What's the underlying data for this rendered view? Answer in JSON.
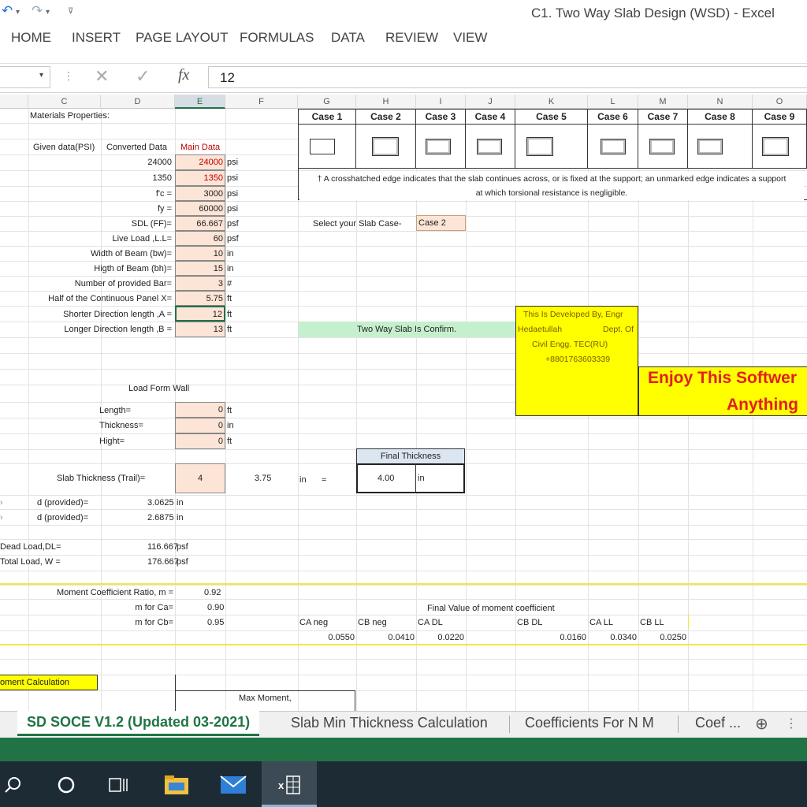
{
  "window": {
    "title": "C1. Two Way Slab Design (WSD) - Excel"
  },
  "ribbon": {
    "tabs": [
      "HOME",
      "INSERT",
      "PAGE LAYOUT",
      "FORMULAS",
      "DATA",
      "REVIEW",
      "VIEW"
    ]
  },
  "formula_bar": {
    "fx_label": "fx",
    "value": "12"
  },
  "columns": [
    "C",
    "D",
    "E",
    "F",
    "G",
    "H",
    "I",
    "J",
    "K",
    "L",
    "M",
    "N",
    "O"
  ],
  "materials": {
    "title": "Materials Properties:",
    "given_hdr": "Given data(PSI)",
    "converted_hdr": "Converted Data",
    "main_hdr": "Main Data",
    "rows": [
      {
        "given": "24000",
        "label": "",
        "main": "24000",
        "unit": "psi"
      },
      {
        "given": "1350",
        "label": "",
        "main": "1350",
        "unit": "psi"
      },
      {
        "given": "f'c =",
        "label": "",
        "main": "3000",
        "unit": "psi"
      },
      {
        "given": "fy =",
        "label": "",
        "main": "60000",
        "unit": "psi"
      },
      {
        "given": "",
        "label": "SDL (FF)=",
        "main": "66.667",
        "unit": "psf"
      },
      {
        "given": "",
        "label": "Live Load ,L.L=",
        "main": "60",
        "unit": "psf"
      },
      {
        "given": "",
        "label": "Width of Beam (bw)=",
        "main": "10",
        "unit": "in"
      },
      {
        "given": "",
        "label": "Higth of Beam (bh)=",
        "main": "15",
        "unit": "in"
      },
      {
        "given": "",
        "label": "Number of provided Bar=",
        "main": "3",
        "unit": "#"
      },
      {
        "given": "",
        "label": "Half of the Continuous Panel X=",
        "main": "5.75",
        "unit": "ft"
      },
      {
        "given": "",
        "label": "Shorter  Direction length ,A =",
        "main": "12",
        "unit": "ft"
      },
      {
        "given": "",
        "label": "Longer  Direction length ,B =",
        "main": "13",
        "unit": "ft"
      }
    ]
  },
  "cases": {
    "labels": [
      "Case 1",
      "Case 2",
      "Case 3",
      "Case 4",
      "Case 5",
      "Case 6",
      "Case 7",
      "Case 8",
      "Case 9"
    ],
    "note1": "† A crosshatched edge indicates that the slab continues across, or is fixed at the support; an unmarked edge indicates a support",
    "note2": "at which torsional resistance is negligible.",
    "select_label": "Select your Slab Case-",
    "selected": "Case 2"
  },
  "confirm_text": "Two Way Slab Is Confirm.",
  "developer": {
    "line1": "This Is Developed By, Engr",
    "line2a": "Hedaetullah",
    "line2b": "Dept. Of",
    "line3": "Civil Engg.    TEC(RU)",
    "line4": "+8801763603339"
  },
  "promo": {
    "line1": "Enjoy This Softwer",
    "line2": "Anything"
  },
  "wall": {
    "title": "Load Form Wall",
    "rows": [
      {
        "label": "Length=",
        "value": "0",
        "unit": "ft"
      },
      {
        "label": "Thickness=",
        "value": "0",
        "unit": "in"
      },
      {
        "label": "Hight=",
        "value": "0",
        "unit": "ft"
      }
    ]
  },
  "thickness": {
    "label": "Slab Thickness (Trail)=",
    "trial": "4",
    "calc": "3.75",
    "unit": "in",
    "approx": "≈",
    "final_title": "Final Thickness",
    "final": "4.00",
    "final_unit": "in"
  },
  "depths": [
    {
      "label": "d (provided)=",
      "value": "3.0625",
      "unit": "in"
    },
    {
      "label": "d (provided)=",
      "value": "2.6875",
      "unit": "in"
    }
  ],
  "loads": [
    {
      "label": "Dead Load,DL=",
      "value": "116.667",
      "unit": "psf"
    },
    {
      "label": "Total Load, W =",
      "value": "176.667",
      "unit": "psf"
    }
  ],
  "moment": {
    "ratio_label": "Moment Coefficient Ratio, m =",
    "ratio": "0.92",
    "ca_label": "m for Ca=",
    "ca": "0.90",
    "cb_label": "m for Cb=",
    "cb": "0.95",
    "final_title": "Final Value of moment coefficient",
    "coef_headers": [
      "CA neg",
      "CB neg",
      "CA DL",
      "CB DL",
      "CA LL",
      "CB LL"
    ],
    "coef_values": [
      "0.0550",
      "0.0410",
      "0.0220",
      "0.0160",
      "0.0340",
      "0.0250"
    ]
  },
  "bottom": {
    "moment_calc": "oment  Calculation",
    "max_moment": "Max Moment,"
  },
  "sheet_tabs": {
    "active": "SD SOCE V1.2 (Updated 03-2021)",
    "tab2": "Slab Min Thickness Calculation",
    "tab3": "Coefficients For  N M",
    "tab4": "Coef ..."
  }
}
